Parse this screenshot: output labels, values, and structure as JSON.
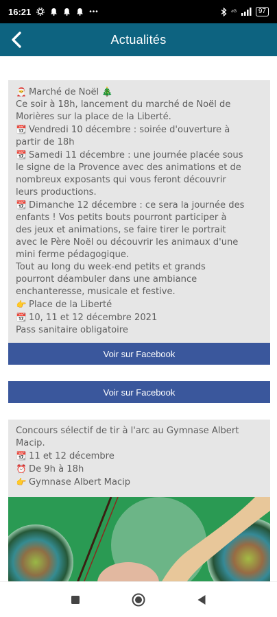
{
  "status_bar": {
    "time": "16:21",
    "icons_left": [
      "settings-icon",
      "bell-icon",
      "bell-icon",
      "bell-icon"
    ],
    "dots": "•••",
    "signal": "⁴ᴳ",
    "battery": "97"
  },
  "app_bar": {
    "title": "Actualités"
  },
  "posts": [
    {
      "lines": [
        {
          "emoji": "🎅",
          "text": "Marché de Noël 🎄"
        },
        {
          "emoji": "",
          "text": "Ce soir à 18h, lancement du marché de Noël de"
        },
        {
          "emoji": "",
          "text": "Morières sur la place de la Liberté."
        },
        {
          "emoji": "📆",
          "text": "Vendredi 10 décembre : soirée d'ouverture à"
        },
        {
          "emoji": "",
          "text": "partir de 18h"
        },
        {
          "emoji": "📆",
          "text": "Samedi 11 décembre : une journée placée sous"
        },
        {
          "emoji": "",
          "text": "le signe de la Provence avec des animations et de"
        },
        {
          "emoji": "",
          "text": "nombreux exposants qui vous feront découvrir"
        },
        {
          "emoji": "",
          "text": "leurs productions."
        },
        {
          "emoji": "📆",
          "text": "Dimanche 12 décembre : ce sera la journée des"
        },
        {
          "emoji": "",
          "text": "enfants ! Vos petits bouts pourront participer à"
        },
        {
          "emoji": "",
          "text": "des jeux et animations, se faire tirer le portrait"
        },
        {
          "emoji": "",
          "text": "avec le Père Noël ou découvrir les animaux d'une"
        },
        {
          "emoji": "",
          "text": "mini ferme pédagogique."
        },
        {
          "emoji": "",
          "text": "Tout au long du week-end petits et grands"
        },
        {
          "emoji": "",
          "text": "pourront déambuler dans une ambiance"
        },
        {
          "emoji": "",
          "text": "enchanteresse, musicale et festive."
        },
        {
          "emoji": "👉",
          "text": "Place de la Liberté"
        },
        {
          "emoji": "📆",
          "text": "10, 11 et 12 décembre 2021"
        },
        {
          "emoji": "",
          "text": "Pass sanitaire obligatoire"
        }
      ],
      "button_label": "Voir sur Facebook"
    },
    {
      "lines": [],
      "button_label": "Voir sur Facebook"
    },
    {
      "lines": [
        {
          "emoji": "",
          "text": "Concours sélectif de tir à l'arc au Gymnase Albert"
        },
        {
          "emoji": "",
          "text": "Macip."
        },
        {
          "emoji": "📆",
          "text": "11 et 12 décembre"
        },
        {
          "emoji": "⏰",
          "text": "De 9h à 18h"
        },
        {
          "emoji": "👉",
          "text": "Gymnase Albert Macip"
        }
      ],
      "image": "archery-photo"
    }
  ],
  "nav_bar": {
    "buttons": [
      "recents-icon",
      "home-icon",
      "back-triangle-icon"
    ]
  },
  "colors": {
    "app_bar": "#0d6380",
    "facebook_button": "#3a579c",
    "card_background": "#e6e6e6",
    "card_text": "#5e5e5e"
  }
}
